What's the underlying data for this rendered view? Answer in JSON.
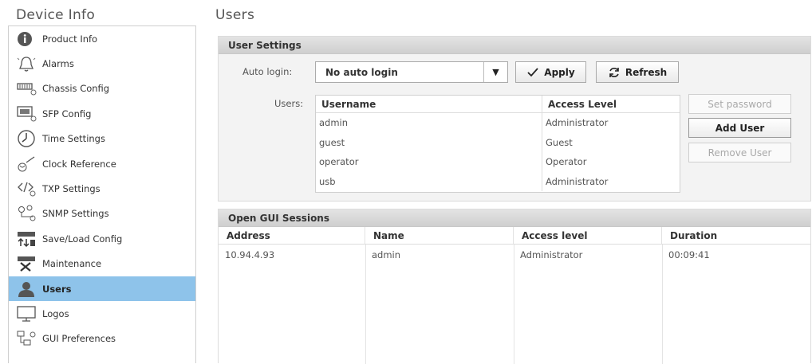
{
  "sidebar": {
    "title": "Device Info",
    "items": [
      {
        "label": "Product Info"
      },
      {
        "label": "Alarms"
      },
      {
        "label": "Chassis Config"
      },
      {
        "label": "SFP Config"
      },
      {
        "label": "Time Settings"
      },
      {
        "label": "Clock Reference"
      },
      {
        "label": "TXP Settings"
      },
      {
        "label": "SNMP Settings"
      },
      {
        "label": "Save/Load Config"
      },
      {
        "label": "Maintenance"
      },
      {
        "label": "Users"
      },
      {
        "label": "Logos"
      },
      {
        "label": "GUI Preferences"
      }
    ],
    "active_color": "#8ec3ea"
  },
  "main": {
    "title": "Users",
    "user_settings": {
      "header": "User Settings",
      "auto_login_label": "Auto login:",
      "auto_login_value": "No auto login",
      "apply_label": "Apply",
      "refresh_label": "Refresh",
      "users_label": "Users:",
      "columns": [
        "Username",
        "Access Level"
      ],
      "rows": [
        [
          "admin",
          "Administrator"
        ],
        [
          "guest",
          "Guest"
        ],
        [
          "operator",
          "Operator"
        ],
        [
          "usb",
          "Administrator"
        ]
      ],
      "set_password_label": "Set password",
      "add_user_label": "Add User",
      "remove_user_label": "Remove User"
    },
    "sessions": {
      "header": "Open GUI Sessions",
      "columns": [
        "Address",
        "Name",
        "Access level",
        "Duration"
      ],
      "rows": [
        [
          "10.94.4.93",
          "admin",
          "Administrator",
          "00:09:41"
        ]
      ]
    }
  }
}
